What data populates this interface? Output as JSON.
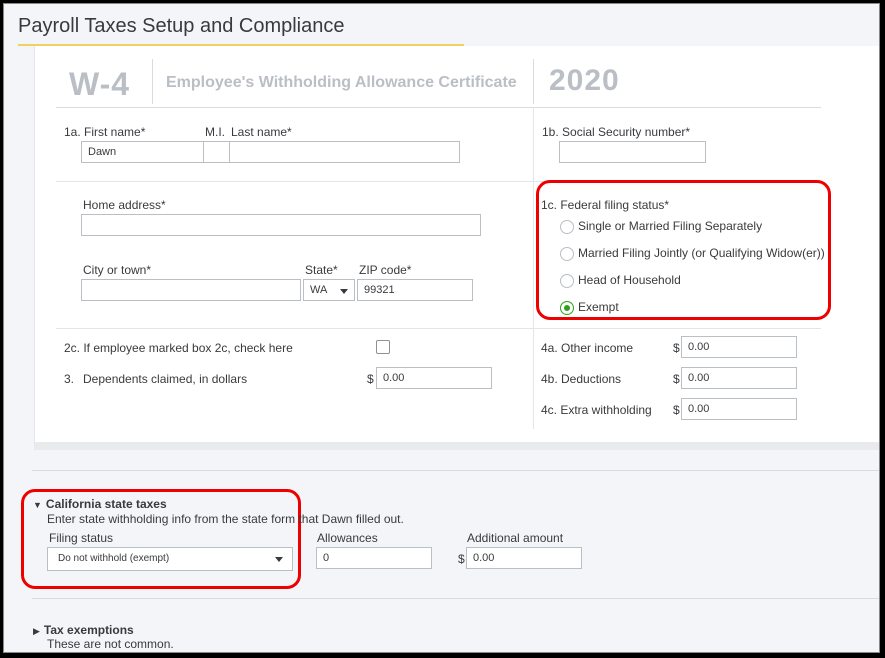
{
  "page": {
    "title": "Payroll Taxes Setup and Compliance"
  },
  "w4": {
    "form_code": "W-4",
    "form_title": "Employee's Withholding Allowance Certificate",
    "year": "2020",
    "first_name_label": "1a. First name*",
    "first_name_value": "Dawn",
    "mi_label": "M.I.",
    "last_name_label": "Last name*",
    "ssn_label": "1b. Social Security number*",
    "home_address_label": "Home address*",
    "city_label": "City or town*",
    "state_label": "State*",
    "state_value": "WA",
    "zip_label": "ZIP code*",
    "zip_value": "99321",
    "filing_status_label": "1c. Federal filing status*",
    "filing_options": [
      {
        "label": "Single or Married Filing Separately",
        "selected": false
      },
      {
        "label": "Married Filing Jointly (or Qualifying Widow(er))",
        "selected": false
      },
      {
        "label": "Head of Household",
        "selected": false
      },
      {
        "label": "Exempt",
        "selected": true
      }
    ],
    "box2c_label": "2c. If employee marked box 2c, check here",
    "dependents_label_num": "3.",
    "dependents_label": "Dependents claimed, in dollars",
    "dependents_value": "0.00",
    "other_income_label": "4a. Other income",
    "other_income_value": "0.00",
    "deductions_label": "4b. Deductions",
    "deductions_value": "0.00",
    "extra_withholding_label": "4c. Extra withholding",
    "extra_withholding_value": "0.00",
    "currency": "$"
  },
  "ca": {
    "section_title": "California state taxes",
    "instructions": "Enter state withholding info from the state form that Dawn filled out.",
    "filing_status_label": "Filing status",
    "filing_status_value": "Do not withhold (exempt)",
    "allowances_label": "Allowances",
    "allowances_value": "0",
    "additional_amount_label": "Additional amount",
    "additional_amount_value": "0.00"
  },
  "exemptions": {
    "section_title": "Tax exemptions",
    "note": "These are not common."
  },
  "colors": {
    "highlight": "#e00000",
    "radio_selected": "#2ca01c",
    "title_underline": "#f0d060"
  }
}
